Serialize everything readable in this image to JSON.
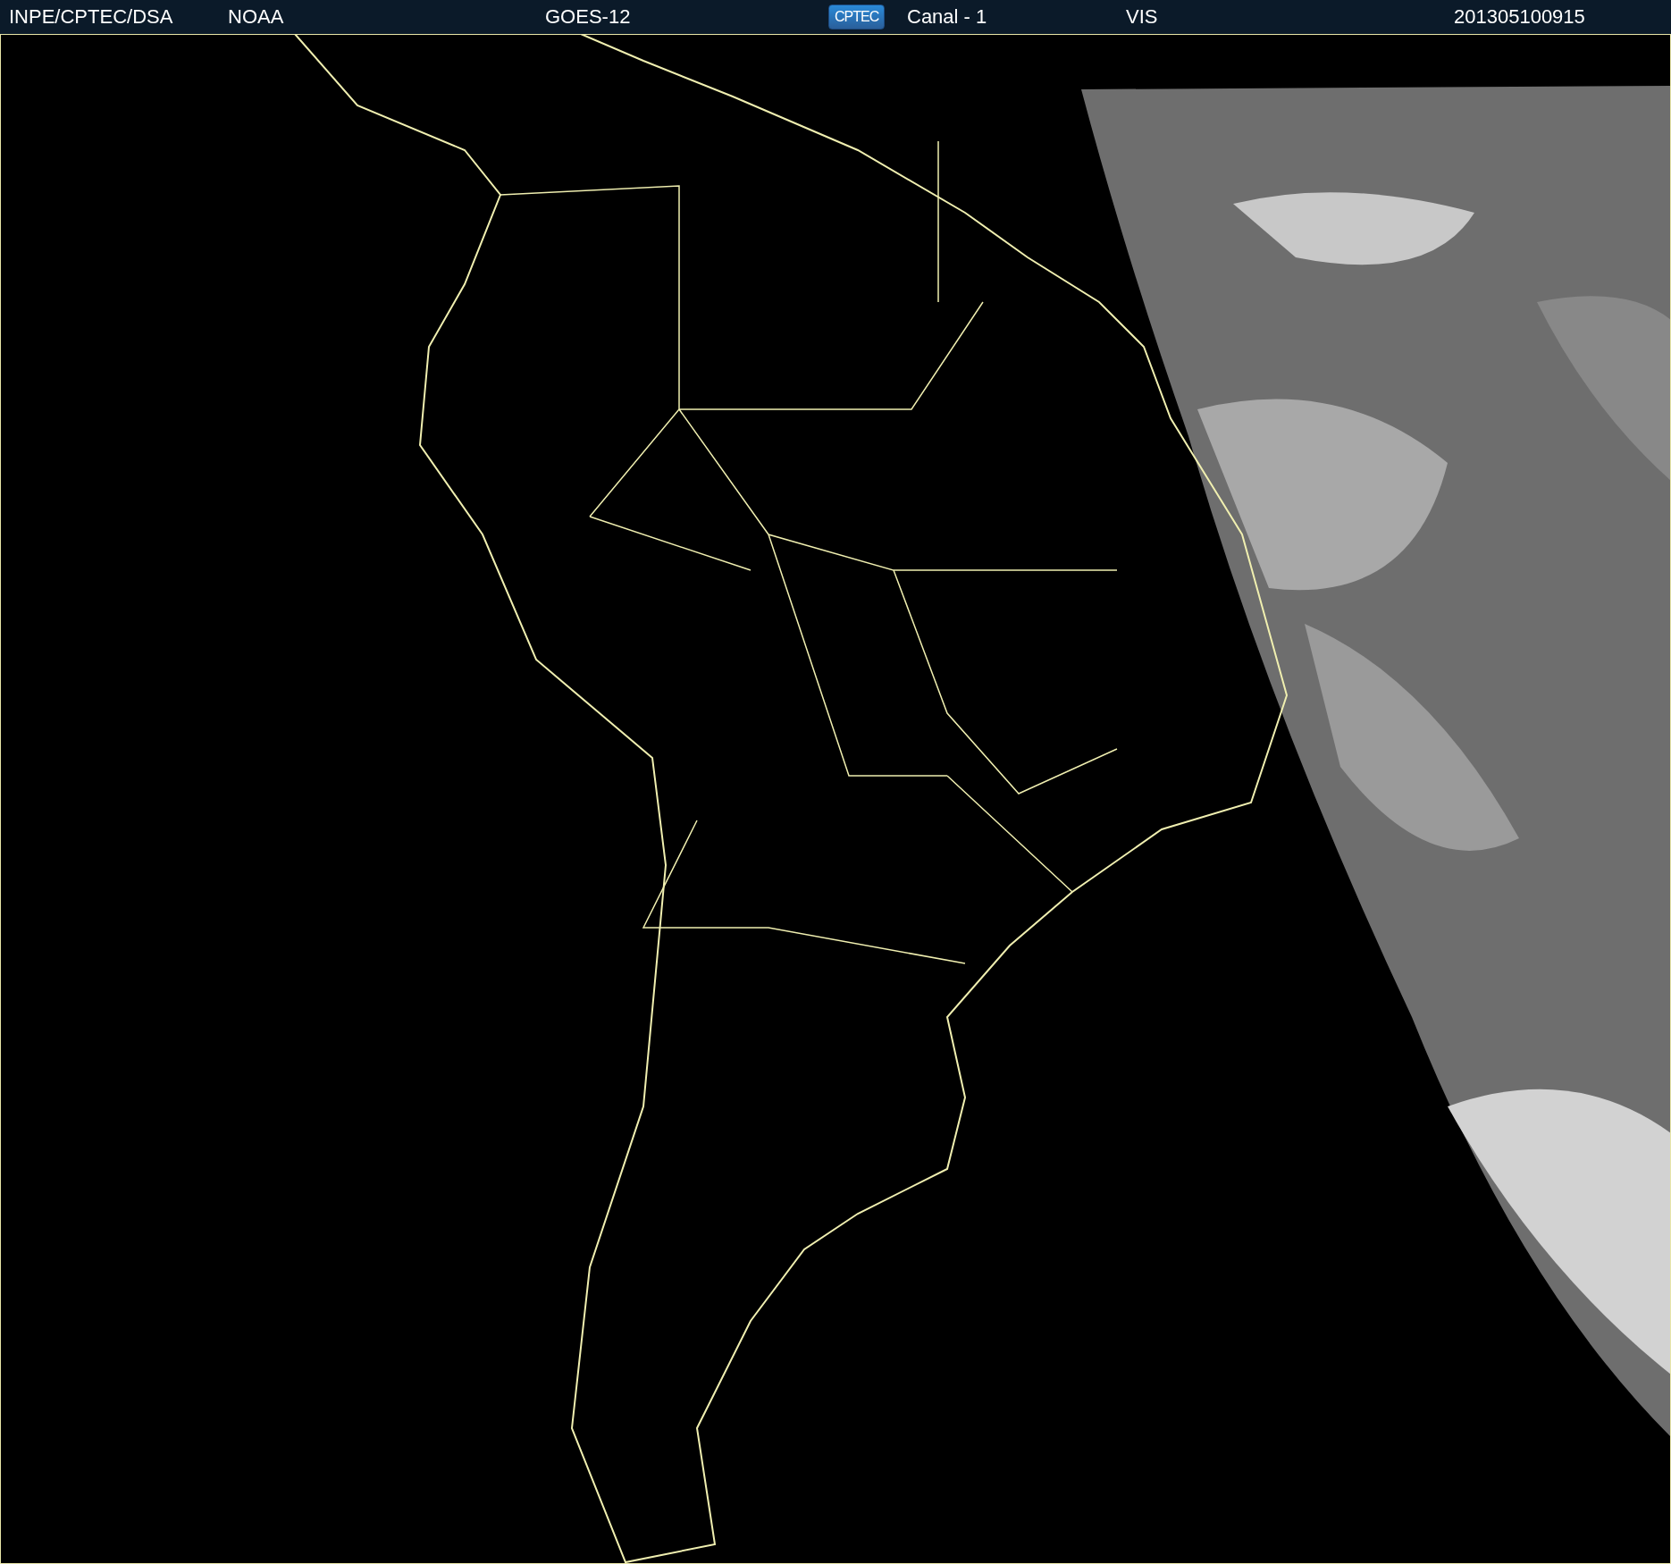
{
  "header": {
    "source": "INPE/CPTEC/DSA",
    "agency": "NOAA",
    "satellite": "GOES-12",
    "logo": "CPTEC",
    "channel": "Canal - 1",
    "band": "VIS",
    "timestamp": "201305100915"
  }
}
